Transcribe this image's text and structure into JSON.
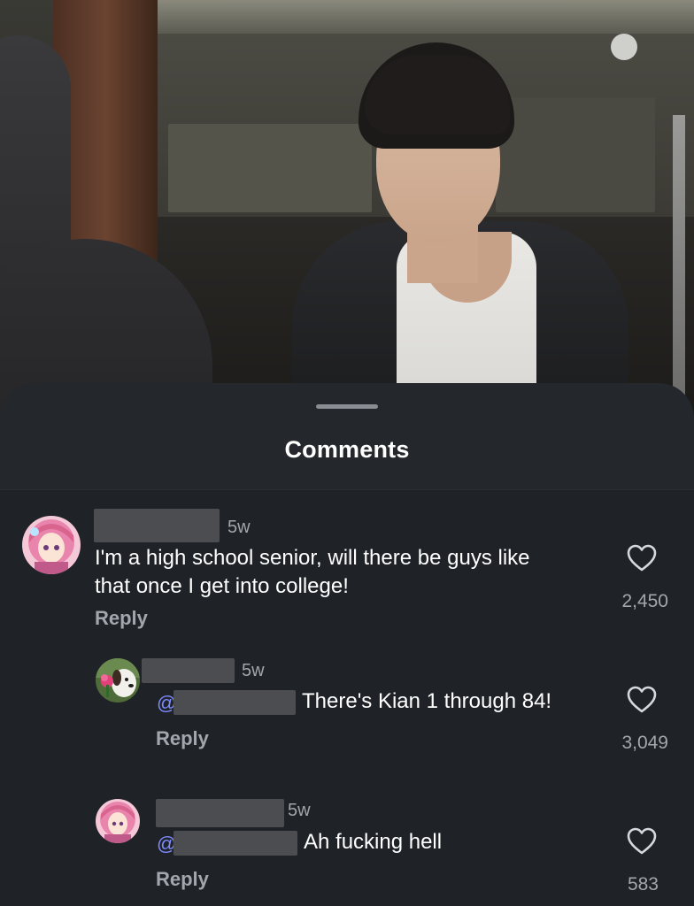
{
  "sheet": {
    "title": "Comments"
  },
  "comments": [
    {
      "timestamp": "5w",
      "text_line1": "I'm a high school senior, will there be guys like",
      "text_line2": "that once I get into college!",
      "reply_label": "Reply",
      "likes": "2,450",
      "avatar_icon": "anime-pink-hair-avatar"
    },
    {
      "timestamp": "5w",
      "mention_prefix": "@",
      "text": "There's Kian 1 through 84!",
      "reply_label": "Reply",
      "likes": "3,049",
      "avatar_icon": "dog-with-flower-avatar"
    },
    {
      "timestamp": "5w",
      "mention_prefix": "@",
      "text": "Ah fucking hell",
      "reply_label": "Reply",
      "likes": "583",
      "avatar_icon": "anime-pink-hair-avatar"
    }
  ],
  "colors": {
    "sheet_bg": "#1f2227",
    "header_bg": "#24272c",
    "text_primary": "#ffffff",
    "text_secondary": "#a3a7ad",
    "redaction": "#4b4d51"
  }
}
